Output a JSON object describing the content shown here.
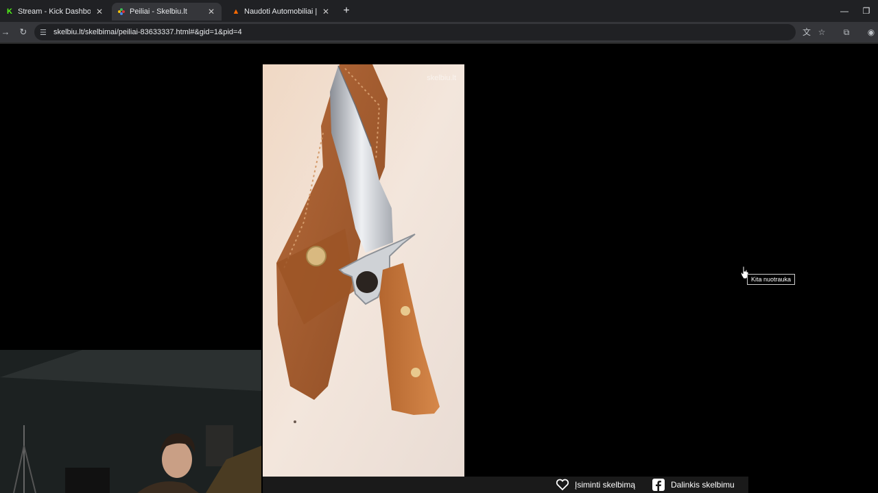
{
  "browser": {
    "tabs": [
      {
        "title": "Stream - Kick Dashboard",
        "favicon": "kick-logo-icon",
        "active": false
      },
      {
        "title": "Peiliai - Skelbiu.lt",
        "favicon": "skelbiu-logo-icon",
        "active": true
      },
      {
        "title": "Naudoti Automobiliai | Patogu",
        "favicon": "autoplius-logo-icon",
        "active": false
      }
    ],
    "url": "skelbiu.lt/skelbimai/peiliai-83633337.html#&gid=1&pid=4"
  },
  "gallery": {
    "watermark": "skelbiu.lt",
    "next_tooltip": "Kita nuotrauka",
    "save_label": "Įsiminti skelbimą",
    "share_label": "Dalinkis skelbimu"
  },
  "colors": {
    "kick_green": "#53fc18",
    "chrome_dark": "#202124",
    "chrome_toolbar": "#35363a",
    "leather": "#a0522d"
  }
}
